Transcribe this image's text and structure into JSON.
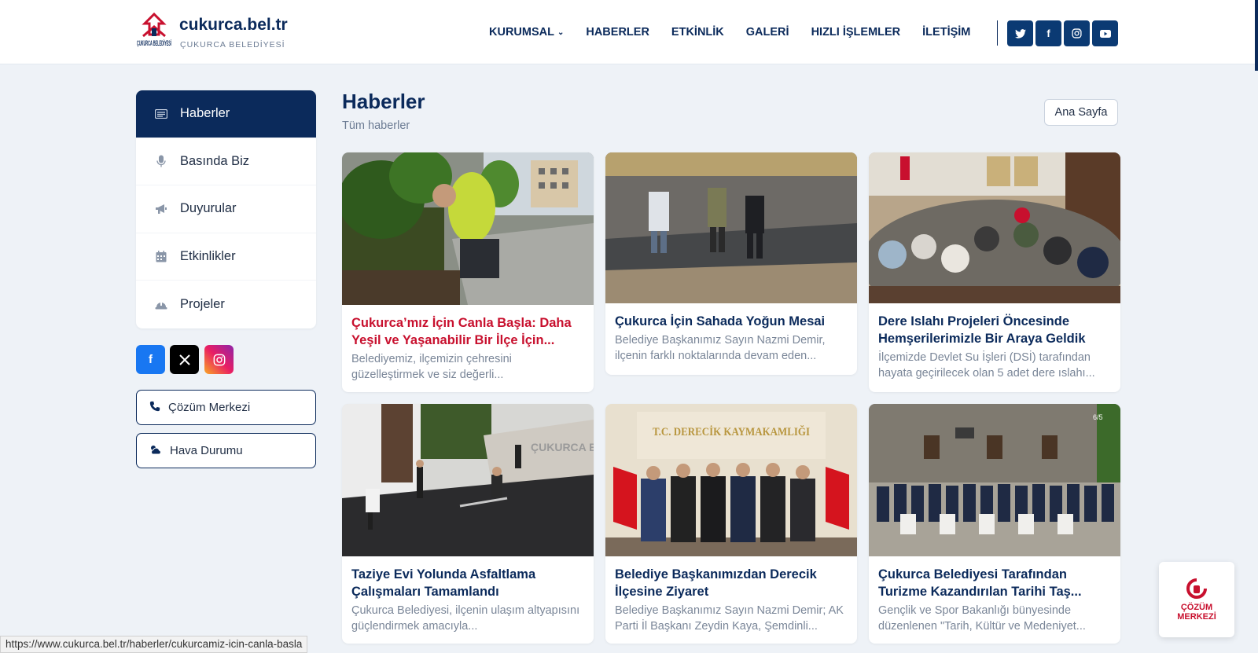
{
  "header": {
    "brand_name": "cukurca.bel.tr",
    "brand_sub": "ÇUKURCA BELEDİYESİ",
    "logo_text": "ÇUKURCA BELEDİYESİ",
    "nav": [
      "KURUMSAL",
      "HABERLER",
      "ETKİNLİK",
      "GALERİ",
      "HIZLI İŞLEMLER",
      "İLETİŞİM"
    ],
    "social_icons": [
      "twitter-icon",
      "facebook-icon",
      "instagram-icon",
      "youtube-icon"
    ]
  },
  "sidebar": {
    "items": [
      {
        "label": "Haberler",
        "icon": "newspaper-icon",
        "active": true
      },
      {
        "label": "Basında Biz",
        "icon": "microphone-icon",
        "active": false
      },
      {
        "label": "Duyurular",
        "icon": "megaphone-icon",
        "active": false
      },
      {
        "label": "Etkinlikler",
        "icon": "calendar-icon",
        "active": false
      },
      {
        "label": "Projeler",
        "icon": "hardhat-icon",
        "active": false
      }
    ],
    "social_icons": [
      "facebook-icon",
      "x-icon",
      "instagram-icon"
    ],
    "buttons": [
      {
        "label": "Çözüm Merkezi",
        "icon": "phone-icon"
      },
      {
        "label": "Hava Durumu",
        "icon": "cloud-sun-icon"
      }
    ]
  },
  "main": {
    "title": "Haberler",
    "subtitle": "Tüm haberler",
    "home_button": "Ana Sayfa",
    "cards": [
      {
        "title": "Çukurca’mız İçin Canla Başla: Daha Yeşil ve Yaşanabilir Bir İlçe İçin...",
        "text": "Belediyemiz, ilçemizin çehresini güzelleştirmek ve siz değerli...",
        "highlight": true
      },
      {
        "title": "Çukurca İçin Sahada Yoğun Mesai",
        "text": "Belediye Başkanımız Sayın Nazmi Demir, ilçenin farklı noktalarında devam eden...",
        "highlight": false
      },
      {
        "title": "Dere Islahı Projeleri Öncesinde Hemşerilerimizle Bir Araya Geldik",
        "text": "İlçemizde Devlet Su İşleri (DSİ) tarafından hayata geçirilecek olan 5 adet dere ıslahı...",
        "highlight": false
      },
      {
        "title": "Taziye Evi Yolunda Asfaltlama Çalışmaları Tamamlandı",
        "text": "Çukurca Belediyesi, ilçenin ulaşım altyapısını güçlendirmek amacıyla...",
        "highlight": false
      },
      {
        "title": "Belediye Başkanımızdan Derecik İlçesine Ziyaret",
        "text": "Belediye Başkanımız Sayın Nazmi Demir; AK Parti İl Başkanı Zeydin Kaya, Şemdinli...",
        "highlight": false
      },
      {
        "title": "Çukurca Belediyesi Tarafından Turizme Kazandırılan Tarihi Taş...",
        "text": "Gençlik ve Spor Bakanlığı bünyesinde düzenlenen \"Tarih, Kültür ve Medeniyet...",
        "highlight": false
      }
    ],
    "photo_texts": {
      "wall_sign": "ÇUKURCA BE",
      "banner": "T.C. DERECİK KAYMAKAMLIĞI",
      "counter": "6/5"
    }
  },
  "status_url": "https://www.cukurca.bel.tr/haberler/cukurcamiz-icin-canla-basla",
  "float_widget": {
    "line1": "ÇÖZÜM",
    "line2": "MERKEZİ"
  },
  "colors": {
    "navy": "#0b2a5b",
    "red": "#c8102e",
    "background": "#eef2f7"
  }
}
